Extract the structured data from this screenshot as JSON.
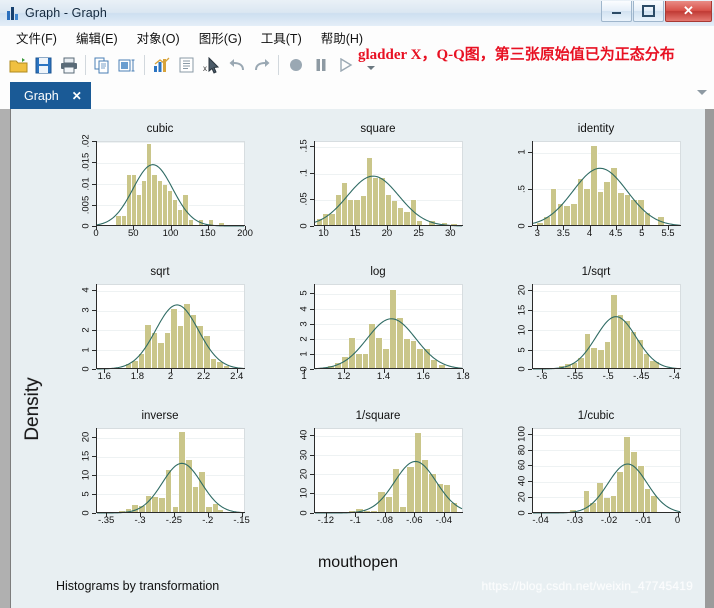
{
  "window": {
    "title": "Graph - Graph",
    "icon": "chart-bars-icon",
    "minimize_label": "–",
    "maximize_label": "□",
    "close_label": "✕"
  },
  "menu": {
    "items": [
      {
        "label": "文件(F)",
        "name": "menu-file"
      },
      {
        "label": "编辑(E)",
        "name": "menu-edit"
      },
      {
        "label": "对象(O)",
        "name": "menu-object"
      },
      {
        "label": "图形(G)",
        "name": "menu-graph"
      },
      {
        "label": "工具(T)",
        "name": "menu-tools"
      },
      {
        "label": "帮助(H)",
        "name": "menu-help"
      }
    ]
  },
  "toolbar": {
    "buttons": [
      {
        "name": "open-folder-icon",
        "title": "Open"
      },
      {
        "name": "save-icon",
        "title": "Save"
      },
      {
        "name": "print-icon",
        "title": "Print"
      },
      {
        "name": "copy-icon",
        "title": "Copy"
      },
      {
        "name": "rename-icon",
        "title": "Rename"
      },
      {
        "name": "new-graph-icon",
        "title": "New Graph"
      },
      {
        "name": "log-icon",
        "title": "Log"
      },
      {
        "name": "pointer-icon",
        "title": "Pointer"
      },
      {
        "name": "undo-icon",
        "title": "Undo"
      },
      {
        "name": "redo-icon",
        "title": "Redo"
      },
      {
        "name": "record-icon",
        "title": "Record"
      },
      {
        "name": "pause-icon",
        "title": "Pause"
      },
      {
        "name": "play-icon",
        "title": "Play"
      },
      {
        "name": "dropdown-arrow-icon",
        "title": "More"
      }
    ]
  },
  "annotation": {
    "text": "gladder X，Q-Q图，第三张原始值已为正态分布",
    "color": "#e81123"
  },
  "tabs": {
    "active": "Graph",
    "close_label": "✕"
  },
  "graph": {
    "ylabel": "Density",
    "xlabel": "mouthopen",
    "note": "Histograms by transformation",
    "watermark": "https://blog.csdn.net/weixin_47745419",
    "bar_color": "#cac68a",
    "curve_color": "#2f6b64",
    "background": "#e8eff2",
    "plot_background": "#ffffff"
  },
  "chart_data": {
    "type": "histogram-grid",
    "title": "",
    "subtitle": "Histograms by transformation",
    "xlabel": "mouthopen",
    "ylabel": "Density",
    "grid": {
      "rows": 3,
      "cols": 3
    },
    "overlay": "normal density curve",
    "panels": [
      {
        "title": "cubic",
        "xticks": [
          "0",
          "50",
          "100",
          "150",
          "200"
        ],
        "xlim": [
          0,
          200
        ],
        "yticks": [
          "0",
          ".005",
          ".01",
          ".015",
          ".02"
        ],
        "ylim": [
          0,
          0.02
        ],
        "bin_centers": [
          30,
          37,
          44,
          51,
          58,
          65,
          72,
          79,
          86,
          93,
          100,
          107,
          114,
          121,
          128,
          142,
          156,
          170
        ],
        "bin_width": 7,
        "values": [
          0.0024,
          0.0024,
          0.0122,
          0.0122,
          0.0073,
          0.0107,
          0.0195,
          0.0122,
          0.0107,
          0.0098,
          0.0083,
          0.0063,
          0.0039,
          0.0073,
          0.0015,
          0.0015,
          0.0015,
          0.0008
        ],
        "curve_peak_x": 76,
        "curve_peak_y": 0.0146
      },
      {
        "title": "square",
        "xticks": [
          "10",
          "15",
          "20",
          "25",
          "30"
        ],
        "xlim": [
          8.5,
          32
        ],
        "yticks": [
          "0",
          ".05",
          ".1",
          ".15"
        ],
        "ylim": [
          0,
          0.16
        ],
        "bin_centers": [
          9.3,
          10.3,
          11.3,
          12.3,
          13.3,
          14.3,
          15.3,
          16.3,
          17.3,
          18.3,
          19.3,
          20.3,
          21.3,
          22.3,
          23.3,
          24.3,
          25.3,
          27.3,
          29.3,
          30.8
        ],
        "bin_width": 1.0,
        "values": [
          0.013,
          0.023,
          0.023,
          0.06,
          0.081,
          0.049,
          0.049,
          0.058,
          0.13,
          0.092,
          0.092,
          0.06,
          0.047,
          0.035,
          0.026,
          0.05,
          0.01,
          0.01,
          0.006,
          0.004
        ],
        "curve_peak_x": 17.8,
        "curve_peak_y": 0.095
      },
      {
        "title": "identity",
        "xticks": [
          "3",
          "3.5",
          "4",
          "4.5",
          "5",
          "5.5"
        ],
        "xlim": [
          2.9,
          5.75
        ],
        "yticks": [
          "0",
          ".5",
          "1"
        ],
        "ylim": [
          0,
          1.15
        ],
        "bin_centers": [
          3.05,
          3.18,
          3.31,
          3.44,
          3.57,
          3.7,
          3.83,
          3.96,
          4.09,
          4.22,
          4.35,
          4.48,
          4.61,
          4.74,
          4.87,
          5.0,
          5.13,
          5.39
        ],
        "bin_width": 0.13,
        "values": [
          0.04,
          0.13,
          0.5,
          0.3,
          0.27,
          0.3,
          0.65,
          0.5,
          1.1,
          0.47,
          0.6,
          0.8,
          0.45,
          0.42,
          0.36,
          0.36,
          0.18,
          0.13
        ],
        "curve_peak_x": 4.2,
        "curve_peak_y": 0.79
      },
      {
        "title": "sqrt",
        "xticks": [
          "1.6",
          "1.8",
          "2",
          "2.2",
          "2.4"
        ],
        "xlim": [
          1.55,
          2.45
        ],
        "yticks": [
          "0",
          "1",
          "2",
          "3",
          "4"
        ],
        "ylim": [
          0,
          4.3
        ],
        "bin_centers": [
          1.745,
          1.785,
          1.825,
          1.865,
          1.905,
          1.945,
          1.985,
          2.025,
          2.065,
          2.105,
          2.145,
          2.185,
          2.225,
          2.265,
          2.305,
          2.345
        ],
        "bin_width": 0.04,
        "values": [
          0.25,
          0.45,
          0.8,
          2.25,
          1.85,
          1.35,
          1.85,
          3.1,
          2.2,
          3.35,
          2.8,
          2.2,
          1.7,
          0.55,
          0.4,
          0.18
        ],
        "curve_peak_x": 2.04,
        "curve_peak_y": 3.28
      },
      {
        "title": "log",
        "xticks": [
          "1",
          "1.2",
          "1.4",
          "1.6",
          "1.8"
        ],
        "xlim": [
          1.05,
          1.8
        ],
        "yticks": [
          "0",
          "1",
          "2",
          "3",
          "4",
          "5"
        ],
        "ylim": [
          0,
          5.6
        ],
        "bin_centers": [
          1.135,
          1.17,
          1.205,
          1.24,
          1.275,
          1.31,
          1.345,
          1.38,
          1.415,
          1.45,
          1.485,
          1.52,
          1.555,
          1.59,
          1.625,
          1.66,
          1.7
        ],
        "bin_width": 0.035,
        "values": [
          0.25,
          0.45,
          0.8,
          2.1,
          1.0,
          1.05,
          3.0,
          2.1,
          1.35,
          5.3,
          3.45,
          2.0,
          1.9,
          1.35,
          1.35,
          0.6,
          0.3
        ],
        "curve_peak_x": 1.44,
        "curve_peak_y": 3.35
      },
      {
        "title": "1/sqrt",
        "xticks": [
          "-.6",
          "-.55",
          "-.5",
          "-.45",
          "-.4"
        ],
        "xlim": [
          -0.615,
          -0.39
        ],
        "yticks": [
          "0",
          "5",
          "10",
          "15",
          "20"
        ],
        "ylim": [
          0,
          21.5
        ],
        "bin_centers": [
          -0.5705,
          -0.5605,
          -0.5505,
          -0.5405,
          -0.5305,
          -0.5205,
          -0.5105,
          -0.5005,
          -0.4905,
          -0.4805,
          -0.4705,
          -0.4605,
          -0.4505,
          -0.4405,
          -0.4305,
          -0.4255
        ],
        "bin_width": 0.01,
        "values": [
          0.8,
          1.4,
          1.6,
          3.0,
          9.0,
          5.5,
          5.0,
          7.0,
          19.0,
          14.0,
          12.5,
          9.5,
          7.5,
          4.0,
          2.2,
          1.8
        ],
        "curve_peak_x": -0.488,
        "curve_peak_y": 13.4
      },
      {
        "title": "inverse",
        "xticks": [
          "-.35",
          "-.3",
          "-.25",
          "-.2",
          "-.15"
        ],
        "xlim": [
          -0.365,
          -0.145
        ],
        "yticks": [
          "0",
          "5",
          "10",
          "15",
          "20"
        ],
        "ylim": [
          0,
          22.5
        ],
        "bin_centers": [
          -0.327,
          -0.317,
          -0.307,
          -0.297,
          -0.287,
          -0.277,
          -0.267,
          -0.257,
          -0.247,
          -0.237,
          -0.227,
          -0.217,
          -0.207,
          -0.197,
          -0.187,
          -0.18
        ],
        "bin_width": 0.01,
        "values": [
          0.5,
          1.0,
          2.0,
          1.7,
          4.5,
          4.2,
          4.0,
          11.5,
          1.5,
          21.5,
          14.0,
          7.0,
          11.0,
          1.5,
          2.2,
          0.6
        ],
        "curve_peak_x": -0.238,
        "curve_peak_y": 13.3
      },
      {
        "title": "1/square",
        "xticks": [
          "-.12",
          "-.1",
          "-.08",
          "-.06",
          "-.04"
        ],
        "xlim": [
          -0.128,
          -0.027
        ],
        "yticks": [
          "0",
          "10",
          "20",
          "30",
          "40"
        ],
        "ylim": [
          0,
          44
        ],
        "bin_centers": [
          -0.112,
          -0.107,
          -0.102,
          -0.097,
          -0.092,
          -0.087,
          -0.082,
          -0.077,
          -0.072,
          -0.067,
          -0.062,
          -0.057,
          -0.052,
          -0.047,
          -0.042,
          -0.037,
          -0.032
        ],
        "bin_width": 0.005,
        "values": [
          0.4,
          0.6,
          0.8,
          2.0,
          0.8,
          1.0,
          11.0,
          8.0,
          23.0,
          3.0,
          24.0,
          41.5,
          27.5,
          20.0,
          15.0,
          14.5,
          5.0
        ],
        "curve_peak_x": -0.059,
        "curve_peak_y": 27.0
      },
      {
        "title": "1/cubic",
        "xticks": [
          "-.04",
          "-.03",
          "-.02",
          "-.01",
          "0"
        ],
        "xlim": [
          -0.0425,
          0.001
        ],
        "yticks": [
          "0",
          "20",
          "40",
          "60",
          "80",
          "100"
        ],
        "ylim": [
          0,
          108
        ],
        "bin_centers": [
          -0.0385,
          -0.0365,
          -0.0345,
          -0.0325,
          -0.0305,
          -0.0285,
          -0.0265,
          -0.0245,
          -0.0225,
          -0.0205,
          -0.0185,
          -0.0165,
          -0.0145,
          -0.0125,
          -0.0105,
          -0.0085,
          -0.0065
        ],
        "bin_width": 0.002,
        "values": [
          1.0,
          1.0,
          1.0,
          1.0,
          4.0,
          1.0,
          28.0,
          12.0,
          38.0,
          19.0,
          21.0,
          52.0,
          97.0,
          78.0,
          60.0,
          30.0,
          21.0
        ],
        "curve_peak_x": -0.0145,
        "curve_peak_y": 63.0
      }
    ]
  }
}
